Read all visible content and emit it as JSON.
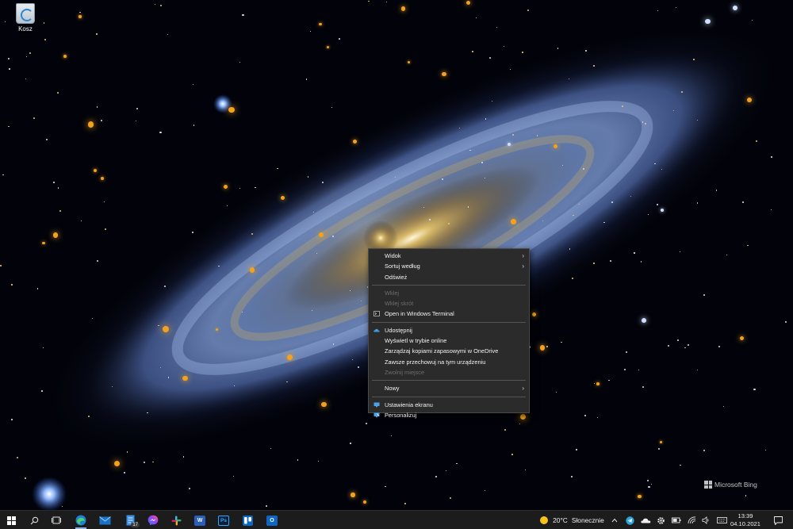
{
  "desktop": {
    "icons": [
      {
        "label": "Kosz",
        "icon": "recycle-bin-icon"
      }
    ],
    "watermark": "Microsoft Bing"
  },
  "context_menu": {
    "items": [
      {
        "label": "Widok",
        "submenu": true,
        "enabled": true
      },
      {
        "label": "Sortuj według",
        "submenu": true,
        "enabled": true
      },
      {
        "label": "Odśwież",
        "enabled": true
      },
      {
        "separator": true
      },
      {
        "label": "Wklej",
        "enabled": false
      },
      {
        "label": "Wklej skrót",
        "enabled": false
      },
      {
        "label": "Open in Windows Terminal",
        "icon": "terminal-icon",
        "enabled": true
      },
      {
        "separator": true
      },
      {
        "label": "Udostępnij",
        "icon": "onedrive-cloud-icon",
        "enabled": true
      },
      {
        "label": "Wyświetl w trybie online",
        "enabled": true
      },
      {
        "label": "Zarządzaj kopiami zapasowymi w OneDrive",
        "enabled": true
      },
      {
        "label": "Zawsze przechowuj na tym urządzeniu",
        "enabled": true
      },
      {
        "label": "Zwolnij miejsce",
        "enabled": false
      },
      {
        "separator": true
      },
      {
        "label": "Nowy",
        "submenu": true,
        "enabled": true
      },
      {
        "separator": true
      },
      {
        "label": "Ustawienia ekranu",
        "icon": "display-settings-icon",
        "enabled": true
      },
      {
        "label": "Personalizuj",
        "icon": "personalize-icon",
        "enabled": true
      }
    ]
  },
  "taskbar": {
    "apps": [
      {
        "name": "start-button",
        "icon": "windows-logo-icon"
      },
      {
        "name": "search-button",
        "icon": "search-icon"
      },
      {
        "name": "task-view-button",
        "icon": "task-view-icon"
      },
      {
        "name": "edge-app",
        "icon": "edge-icon",
        "active": true
      },
      {
        "name": "mail-app",
        "icon": "mail-icon"
      },
      {
        "name": "files-app",
        "icon": "file-icon",
        "badge": "17"
      },
      {
        "name": "messenger-app",
        "icon": "messenger-icon"
      },
      {
        "name": "slack-app",
        "icon": "slack-icon"
      },
      {
        "name": "word-app",
        "icon": "word-icon",
        "glyph": "W"
      },
      {
        "name": "photoshop-app",
        "icon": "photoshop-icon",
        "glyph": "Ps"
      },
      {
        "name": "trello-app",
        "icon": "trello-icon"
      },
      {
        "name": "outlook-app",
        "icon": "outlook-icon",
        "glyph": "O"
      }
    ],
    "weather": {
      "temp": "20°C",
      "condition": "Słonecznie",
      "icon": "sun-icon"
    },
    "tray_icons": [
      "chevron-up-icon",
      "telegram-icon",
      "onedrive-icon",
      "settings-gear-icon",
      "battery-icon",
      "wifi-icon",
      "volume-icon",
      "keyboard-icon"
    ],
    "clock": {
      "time": "13:39",
      "date": "04.10.2021"
    },
    "notification_icon": "notification-icon"
  },
  "colors": {
    "taskbar": "#1c1c1c",
    "menu_bg": "#2b2b2b",
    "menu_text": "#f2f2f2",
    "menu_disabled": "#6d6d6d",
    "accent": "#8ab4e8"
  }
}
